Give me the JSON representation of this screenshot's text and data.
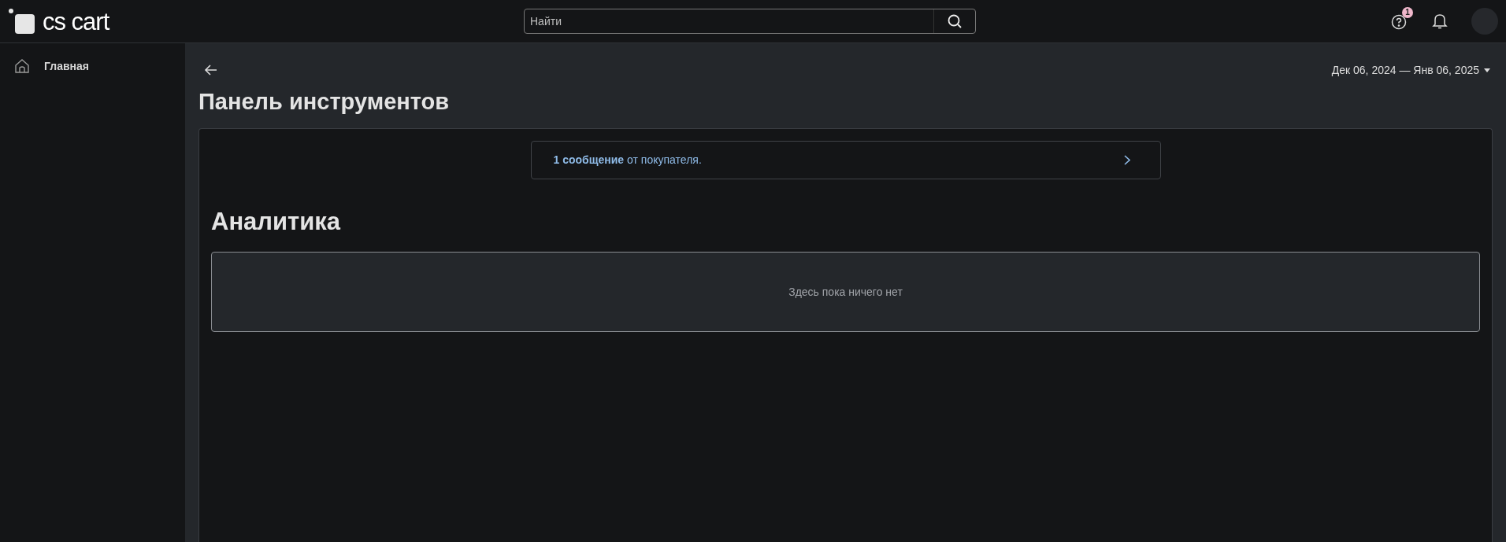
{
  "header": {
    "logo": "cs cart",
    "search": {
      "placeholder": "Найти"
    },
    "help_badge": "1"
  },
  "sidebar": {
    "items": [
      {
        "label": "Главная",
        "selected": false
      }
    ]
  },
  "date_range": "Дек 06, 2024 — Янв 06, 2025",
  "page_title": "Панель инструментов",
  "notice": "**1 сообщение** от покупателя.",
  "analytics": {
    "title": "Аналитика",
    "empty_text": "Здесь пока ничего нет"
  }
}
